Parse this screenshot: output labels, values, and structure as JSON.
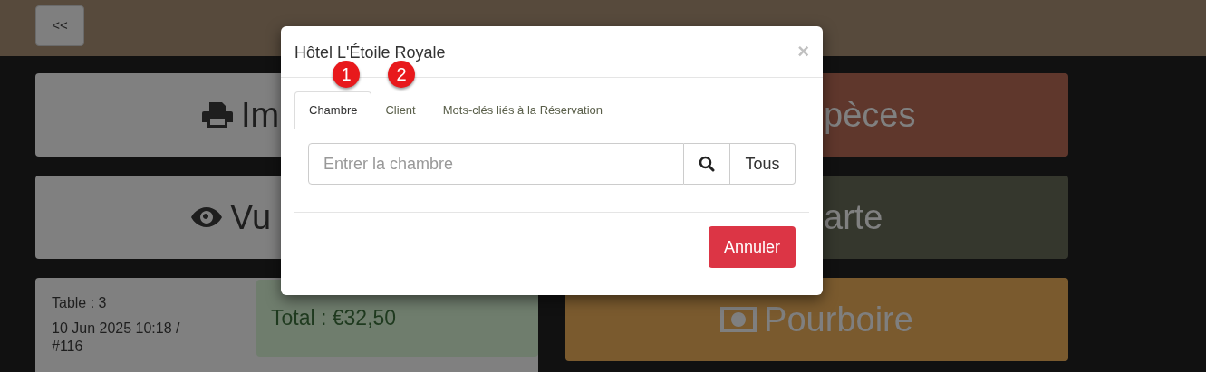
{
  "top_bar": {
    "back_button": "<<"
  },
  "background_buttons": [
    {
      "kind": "print",
      "label": "Im"
    },
    {
      "kind": "cash",
      "label": "pèces"
    },
    {
      "kind": "view",
      "label": "Vu"
    },
    {
      "kind": "card",
      "label": "arte"
    }
  ],
  "order": {
    "table": "Table : 3",
    "date": "10 Jun 2025 10:18 / #116",
    "total": "Total : €32,50"
  },
  "tip_button": {
    "label": "Pourboire"
  },
  "modal": {
    "title": "Hôtel L'Étoile Royale",
    "close": "×",
    "badges": [
      "1",
      "2"
    ],
    "tabs": [
      {
        "label": "Chambre",
        "selected": true
      },
      {
        "label": "Client",
        "selected": false
      },
      {
        "label": "Mots-clés liés à la Réservation",
        "selected": false
      }
    ],
    "search": {
      "placeholder": "Entrer la chambre",
      "all_button": "Tous"
    },
    "cancel_button": "Annuler"
  }
}
